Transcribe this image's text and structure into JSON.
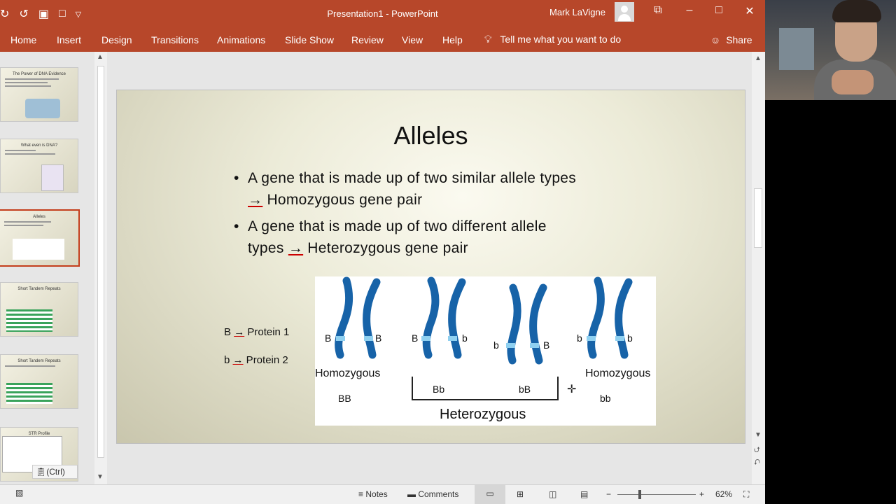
{
  "window": {
    "title": "Presentation1  -  PowerPoint",
    "user": "Mark LaVigne"
  },
  "ribbon": {
    "tabs": [
      "Home",
      "Insert",
      "Design",
      "Transitions",
      "Animations",
      "Slide Show",
      "Review",
      "View",
      "Help"
    ],
    "tell_me": "Tell me what you want to do",
    "share": "Share"
  },
  "thumbnails": [
    {
      "title": "The Power of DNA Evidence"
    },
    {
      "title": "What even is DNA?"
    },
    {
      "title": "Alleles"
    },
    {
      "title": "Short Tandem Repeats"
    },
    {
      "title": "Short Tandem Repeats"
    },
    {
      "title": "STR Profile"
    }
  ],
  "paste_ctrl": "(Ctrl)",
  "slide": {
    "title": "Alleles",
    "bullet1_line1": "A gene that is made up of two similar allele types",
    "bullet1_arrow": "→",
    "bullet1_line2": " Homozygous gene pair",
    "bullet2_line1": "A gene that is made up of two different allele",
    "bullet2_line2_a": "types ",
    "bullet2_arrow": "→",
    "bullet2_line2_b": " Heterozygous gene pair",
    "legend1_a": "B ",
    "legend1_arrow": "→",
    "legend1_b": " Protein 1",
    "legend2_a": "b ",
    "legend2_arrow": "→",
    "legend2_b": " Protein 2",
    "figure": {
      "homozygous_left": "Homozygous",
      "homozygous_right": "Homozygous",
      "heterozygous": "Heterozygous",
      "BB": "BB",
      "Bb": "Bb",
      "bB": "bB",
      "bb": "bb",
      "allele_B": "B",
      "allele_b": "b"
    }
  },
  "status": {
    "notes": "Notes",
    "comments": "Comments",
    "zoom": "62%"
  },
  "colors": {
    "accent": "#b7472a",
    "chromosome": "#1763a8",
    "band": "#8fd0f0"
  }
}
